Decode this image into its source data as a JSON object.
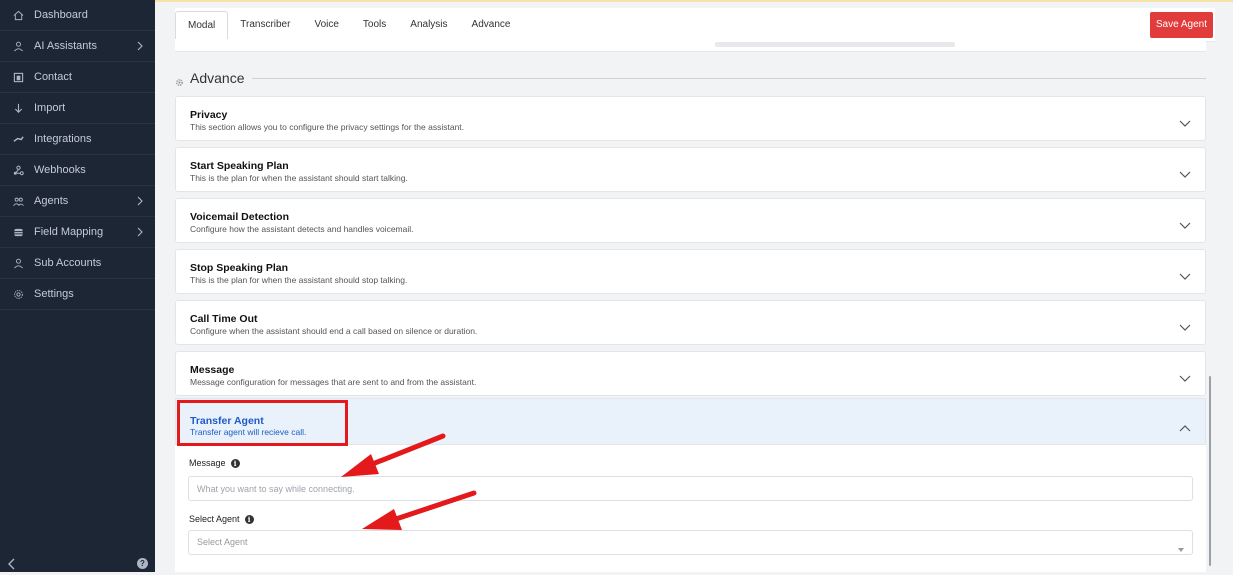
{
  "sidebar": {
    "items": [
      {
        "label": "Dashboard",
        "icon": "home-icon",
        "has_submenu": false
      },
      {
        "label": "AI Assistants",
        "icon": "user-icon",
        "has_submenu": true
      },
      {
        "label": "Contact",
        "icon": "contact-icon",
        "has_submenu": false
      },
      {
        "label": "Import",
        "icon": "import-icon",
        "has_submenu": false
      },
      {
        "label": "Integrations",
        "icon": "plug-icon",
        "has_submenu": false
      },
      {
        "label": "Webhooks",
        "icon": "webhook-icon",
        "has_submenu": false
      },
      {
        "label": "Agents",
        "icon": "users-icon",
        "has_submenu": true
      },
      {
        "label": "Field Mapping",
        "icon": "database-icon",
        "has_submenu": true
      },
      {
        "label": "Sub Accounts",
        "icon": "user-icon",
        "has_submenu": false
      },
      {
        "label": "Settings",
        "icon": "gear-icon",
        "has_submenu": false
      }
    ]
  },
  "header": {
    "tabs": [
      {
        "label": "Modal",
        "active": true
      },
      {
        "label": "Transcriber",
        "active": false
      },
      {
        "label": "Voice",
        "active": false
      },
      {
        "label": "Tools",
        "active": false
      },
      {
        "label": "Analysis",
        "active": false
      },
      {
        "label": "Advance",
        "active": false
      }
    ],
    "save_label": "Save Agent"
  },
  "section": {
    "title": "Advance"
  },
  "cards": [
    {
      "title": "Privacy",
      "desc": "This section allows you to configure the privacy settings for the assistant."
    },
    {
      "title": "Start Speaking Plan",
      "desc": "This is the plan for when the assistant should start talking."
    },
    {
      "title": "Voicemail Detection",
      "desc": "Configure how the assistant detects and handles voicemail."
    },
    {
      "title": "Stop Speaking Plan",
      "desc": "This is the plan for when the assistant should stop talking."
    },
    {
      "title": "Call Time Out",
      "desc": "Configure when the assistant should end a call based on silence or duration."
    },
    {
      "title": "Message",
      "desc": "Message configuration for messages that are sent to and from the assistant."
    }
  ],
  "transfer": {
    "title": "Transfer Agent",
    "desc": "Transfer agent will recieve call.",
    "message_label": "Message",
    "message_placeholder": "What you want to say while connecting.",
    "agent_label": "Select Agent",
    "agent_placeholder": "Select Agent"
  },
  "colors": {
    "sidebar_bg": "#1c2635",
    "accent_blue": "#1d5cc8",
    "save_red": "#e23b3b",
    "annotation_red": "#e3191b"
  }
}
